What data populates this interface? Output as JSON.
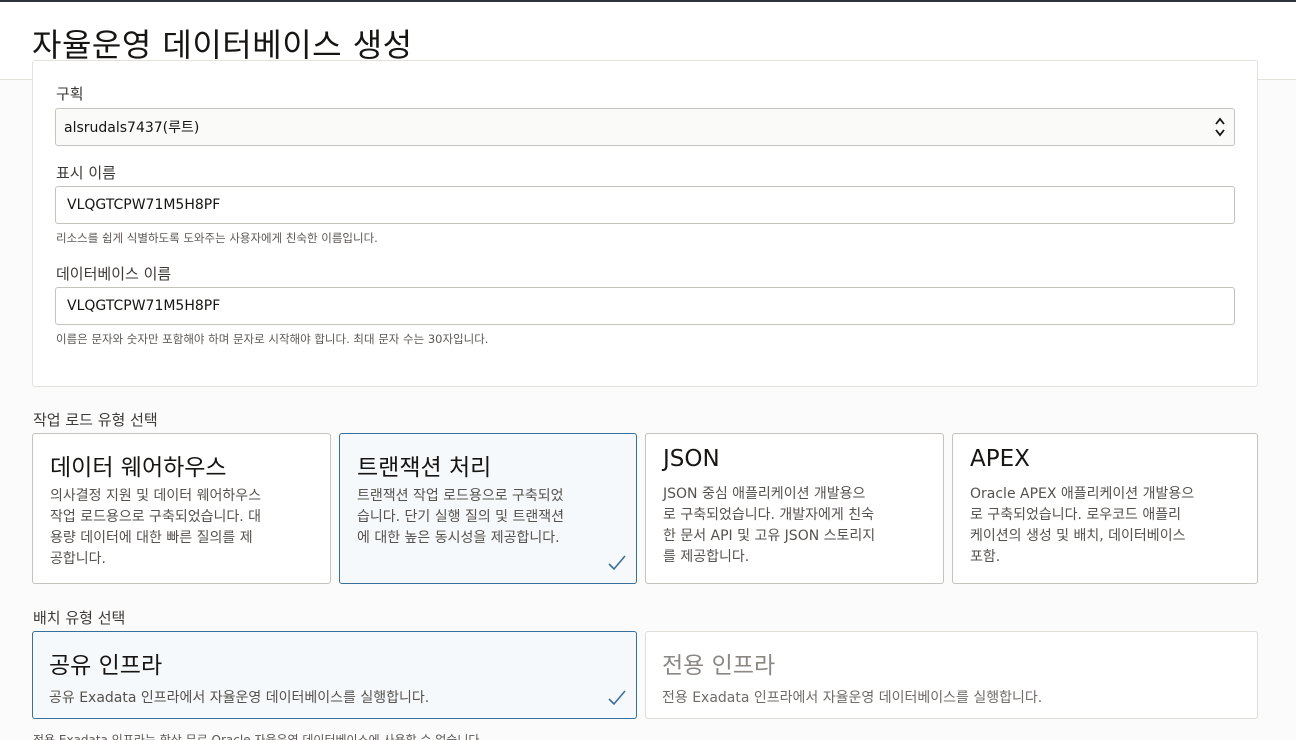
{
  "header": {
    "title": "자율운영 데이터베이스 생성"
  },
  "form": {
    "compartment": {
      "label": "구획",
      "value": "alsrudals7437(루트)"
    },
    "display_name": {
      "label": "표시 이름",
      "value": "VLQGTCPW71M5H8PF",
      "hint": "리소스를 쉽게 식별하도록 도와주는 사용자에게 친숙한 이름입니다."
    },
    "database_name": {
      "label": "데이터베이스 이름",
      "value": "VLQGTCPW71M5H8PF",
      "hint": "이름은 문자와 숫자만 포함해야 하며 문자로 시작해야 합니다. 최대 문자 수는 30자입니다."
    }
  },
  "workload": {
    "label": "작업 로드 유형 선택",
    "options": [
      {
        "title": "데이터 웨어하우스",
        "desc": [
          "의사결정 지원 및 데이터 웨어하우스",
          "작업 로드용으로 구축되었습니다. 대",
          "용량 데이터에 대한 빠른 질의를 제",
          "공합니다."
        ],
        "selected": false
      },
      {
        "title": "트랜잭션 처리",
        "desc": [
          "트랜잭션 작업 로드용으로 구축되었",
          "습니다. 단기 실행 질의 및 트랜잭션",
          "에 대한 높은 동시성을 제공합니다."
        ],
        "selected": true
      },
      {
        "title": "JSON",
        "desc": [
          "JSON 중심 애플리케이션 개발용으",
          "로 구축되었습니다. 개발자에게 친숙",
          "한 문서 API 및 고유 JSON 스토리지",
          "를 제공합니다."
        ],
        "selected": false
      },
      {
        "title": "APEX",
        "desc": [
          "Oracle APEX 애플리케이션 개발용으",
          "로 구축되었습니다. 로우코드 애플리",
          "케이션의 생성 및 배치, 데이터베이스",
          "포함."
        ],
        "selected": false
      }
    ]
  },
  "deployment": {
    "label": "배치 유형 선택",
    "options": [
      {
        "title": "공유 인프라",
        "desc": "공유 Exadata 인프라에서 자율운영 데이터베이스를 실행합니다.",
        "selected": true
      },
      {
        "title": "전용 인프라",
        "desc": "전용 Exadata 인프라에서 자율운영 데이터베이스를 실행합니다.",
        "selected": false
      }
    ],
    "hint": "전용 Exadata 인프라는 항상 무료 Oracle 자율운영 데이터베이스에 사용할 수 없습니다."
  },
  "colors": {
    "selected_border": "#3a6f9a",
    "selected_bg": "#f6f9fc",
    "check": "#3a6f9a"
  },
  "icons": {
    "select_arrows": "chevron-up-down-icon",
    "selected_check": "checkmark-icon"
  }
}
